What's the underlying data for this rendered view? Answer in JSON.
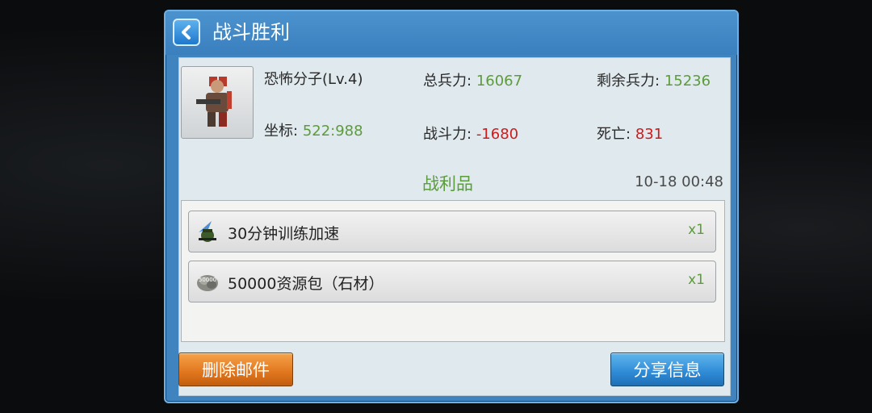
{
  "dialog": {
    "title": "战斗胜利"
  },
  "battle": {
    "enemy_name": "恐怖分子(Lv.4)",
    "coords_label": "坐标:",
    "coords_value": "522:988",
    "total_troops_label": "总兵力:",
    "total_troops_value": "16067",
    "remaining_troops_label": "剩余兵力:",
    "remaining_troops_value": "15236",
    "combat_power_label": "战斗力:",
    "combat_power_value": "-1680",
    "deaths_label": "死亡:",
    "deaths_value": "831"
  },
  "loot": {
    "title": "战利品",
    "timestamp": "10-18 00:48",
    "items": [
      {
        "name": "30分钟训练加速",
        "qty": "x1",
        "icon": "training-speedup-icon"
      },
      {
        "name": "50000资源包（石材）",
        "qty": "x1",
        "icon": "stone-resource-pack-icon",
        "icon_text": "50000"
      }
    ]
  },
  "buttons": {
    "delete": "删除邮件",
    "share": "分享信息"
  },
  "colors": {
    "positive": "#5d9b3c",
    "negative": "#d01a1a",
    "dialog_blue": "#3f84bf"
  }
}
